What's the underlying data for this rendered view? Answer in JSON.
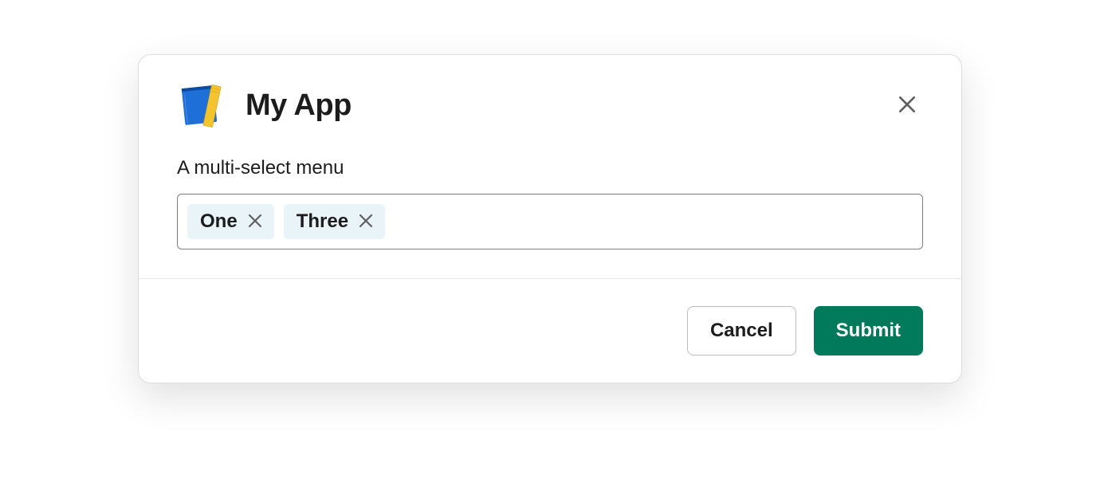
{
  "header": {
    "title": "My App"
  },
  "body": {
    "field_label": "A multi-select menu",
    "selected": [
      {
        "label": "One"
      },
      {
        "label": "Three"
      }
    ]
  },
  "footer": {
    "cancel_label": "Cancel",
    "submit_label": "Submit"
  }
}
